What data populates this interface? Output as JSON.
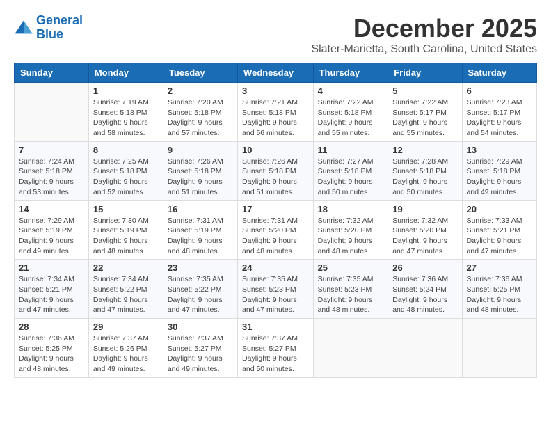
{
  "logo": {
    "line1": "General",
    "line2": "Blue"
  },
  "title": "December 2025",
  "location": "Slater-Marietta, South Carolina, United States",
  "days_of_week": [
    "Sunday",
    "Monday",
    "Tuesday",
    "Wednesday",
    "Thursday",
    "Friday",
    "Saturday"
  ],
  "weeks": [
    [
      {
        "day": "",
        "info": ""
      },
      {
        "day": "1",
        "info": "Sunrise: 7:19 AM\nSunset: 5:18 PM\nDaylight: 9 hours\nand 58 minutes."
      },
      {
        "day": "2",
        "info": "Sunrise: 7:20 AM\nSunset: 5:18 PM\nDaylight: 9 hours\nand 57 minutes."
      },
      {
        "day": "3",
        "info": "Sunrise: 7:21 AM\nSunset: 5:18 PM\nDaylight: 9 hours\nand 56 minutes."
      },
      {
        "day": "4",
        "info": "Sunrise: 7:22 AM\nSunset: 5:18 PM\nDaylight: 9 hours\nand 55 minutes."
      },
      {
        "day": "5",
        "info": "Sunrise: 7:22 AM\nSunset: 5:17 PM\nDaylight: 9 hours\nand 55 minutes."
      },
      {
        "day": "6",
        "info": "Sunrise: 7:23 AM\nSunset: 5:17 PM\nDaylight: 9 hours\nand 54 minutes."
      }
    ],
    [
      {
        "day": "7",
        "info": "Sunrise: 7:24 AM\nSunset: 5:18 PM\nDaylight: 9 hours\nand 53 minutes."
      },
      {
        "day": "8",
        "info": "Sunrise: 7:25 AM\nSunset: 5:18 PM\nDaylight: 9 hours\nand 52 minutes."
      },
      {
        "day": "9",
        "info": "Sunrise: 7:26 AM\nSunset: 5:18 PM\nDaylight: 9 hours\nand 51 minutes."
      },
      {
        "day": "10",
        "info": "Sunrise: 7:26 AM\nSunset: 5:18 PM\nDaylight: 9 hours\nand 51 minutes."
      },
      {
        "day": "11",
        "info": "Sunrise: 7:27 AM\nSunset: 5:18 PM\nDaylight: 9 hours\nand 50 minutes."
      },
      {
        "day": "12",
        "info": "Sunrise: 7:28 AM\nSunset: 5:18 PM\nDaylight: 9 hours\nand 50 minutes."
      },
      {
        "day": "13",
        "info": "Sunrise: 7:29 AM\nSunset: 5:18 PM\nDaylight: 9 hours\nand 49 minutes."
      }
    ],
    [
      {
        "day": "14",
        "info": "Sunrise: 7:29 AM\nSunset: 5:19 PM\nDaylight: 9 hours\nand 49 minutes."
      },
      {
        "day": "15",
        "info": "Sunrise: 7:30 AM\nSunset: 5:19 PM\nDaylight: 9 hours\nand 48 minutes."
      },
      {
        "day": "16",
        "info": "Sunrise: 7:31 AM\nSunset: 5:19 PM\nDaylight: 9 hours\nand 48 minutes."
      },
      {
        "day": "17",
        "info": "Sunrise: 7:31 AM\nSunset: 5:20 PM\nDaylight: 9 hours\nand 48 minutes."
      },
      {
        "day": "18",
        "info": "Sunrise: 7:32 AM\nSunset: 5:20 PM\nDaylight: 9 hours\nand 48 minutes."
      },
      {
        "day": "19",
        "info": "Sunrise: 7:32 AM\nSunset: 5:20 PM\nDaylight: 9 hours\nand 47 minutes."
      },
      {
        "day": "20",
        "info": "Sunrise: 7:33 AM\nSunset: 5:21 PM\nDaylight: 9 hours\nand 47 minutes."
      }
    ],
    [
      {
        "day": "21",
        "info": "Sunrise: 7:34 AM\nSunset: 5:21 PM\nDaylight: 9 hours\nand 47 minutes."
      },
      {
        "day": "22",
        "info": "Sunrise: 7:34 AM\nSunset: 5:22 PM\nDaylight: 9 hours\nand 47 minutes."
      },
      {
        "day": "23",
        "info": "Sunrise: 7:35 AM\nSunset: 5:22 PM\nDaylight: 9 hours\nand 47 minutes."
      },
      {
        "day": "24",
        "info": "Sunrise: 7:35 AM\nSunset: 5:23 PM\nDaylight: 9 hours\nand 47 minutes."
      },
      {
        "day": "25",
        "info": "Sunrise: 7:35 AM\nSunset: 5:23 PM\nDaylight: 9 hours\nand 48 minutes."
      },
      {
        "day": "26",
        "info": "Sunrise: 7:36 AM\nSunset: 5:24 PM\nDaylight: 9 hours\nand 48 minutes."
      },
      {
        "day": "27",
        "info": "Sunrise: 7:36 AM\nSunset: 5:25 PM\nDaylight: 9 hours\nand 48 minutes."
      }
    ],
    [
      {
        "day": "28",
        "info": "Sunrise: 7:36 AM\nSunset: 5:25 PM\nDaylight: 9 hours\nand 48 minutes."
      },
      {
        "day": "29",
        "info": "Sunrise: 7:37 AM\nSunset: 5:26 PM\nDaylight: 9 hours\nand 49 minutes."
      },
      {
        "day": "30",
        "info": "Sunrise: 7:37 AM\nSunset: 5:27 PM\nDaylight: 9 hours\nand 49 minutes."
      },
      {
        "day": "31",
        "info": "Sunrise: 7:37 AM\nSunset: 5:27 PM\nDaylight: 9 hours\nand 50 minutes."
      },
      {
        "day": "",
        "info": ""
      },
      {
        "day": "",
        "info": ""
      },
      {
        "day": "",
        "info": ""
      }
    ]
  ]
}
